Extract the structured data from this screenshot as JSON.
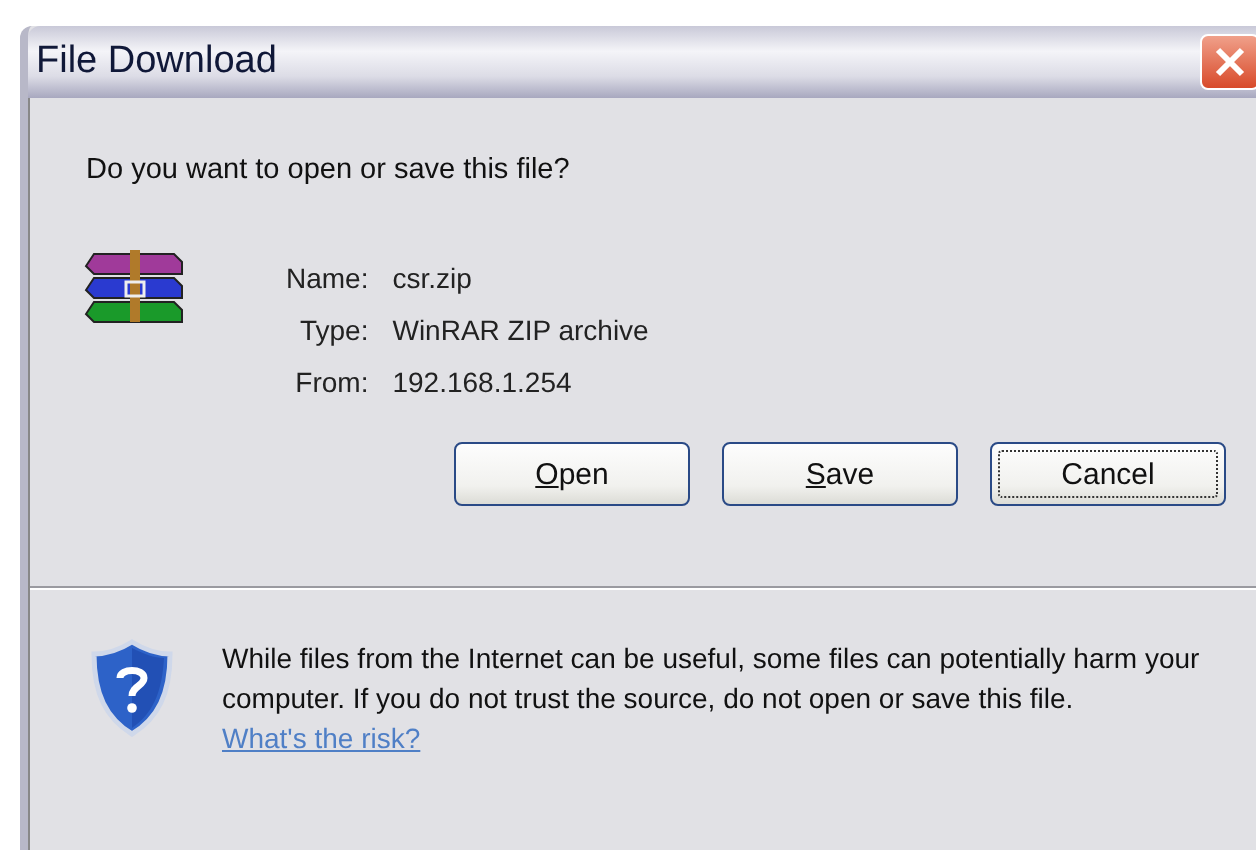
{
  "window": {
    "title": "File Download"
  },
  "prompt": "Do you want to open or save this file?",
  "file_info": [
    {
      "label": "Name:",
      "value": "csr.zip"
    },
    {
      "label": "Type:",
      "value": "WinRAR ZIP archive"
    },
    {
      "label": "From:",
      "value": "192.168.1.254"
    }
  ],
  "buttons": [
    {
      "label": "Open",
      "mnemonic": true,
      "focused": false
    },
    {
      "label": "Save",
      "mnemonic": true,
      "focused": false
    },
    {
      "label": "Cancel",
      "mnemonic": false,
      "focused": true
    }
  ],
  "warning": {
    "text": "While files from the Internet can be useful, some files can potentially harm your computer. If you do not trust the source, do not open or save this file.",
    "link": "What's the risk?"
  }
}
